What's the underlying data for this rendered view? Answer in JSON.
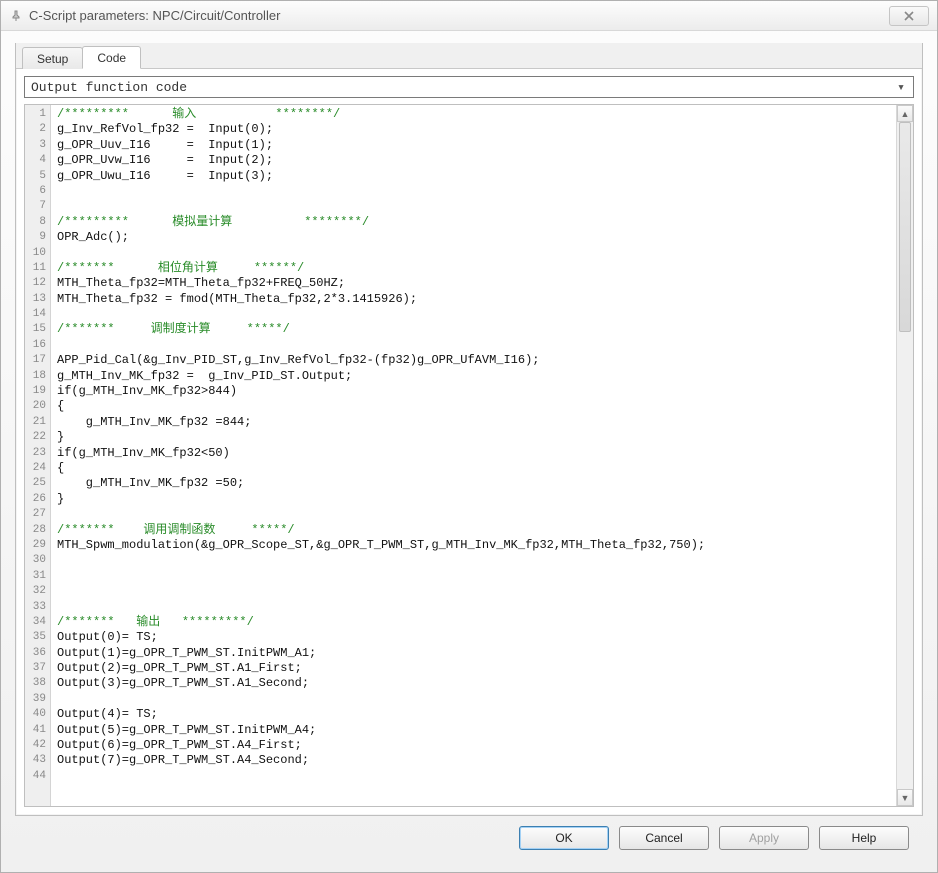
{
  "window": {
    "title": "C-Script parameters: NPC/Circuit/Controller"
  },
  "tabs": {
    "setup": "Setup",
    "code": "Code",
    "activeIndex": 1
  },
  "dropdown": {
    "selected": "Output function code"
  },
  "editor": {
    "lines": [
      {
        "n": 1,
        "t": "/*********      输入           ********/",
        "comment": true
      },
      {
        "n": 2,
        "t": "g_Inv_RefVol_fp32 =  Input(0);"
      },
      {
        "n": 3,
        "t": "g_OPR_Uuv_I16     =  Input(1);"
      },
      {
        "n": 4,
        "t": "g_OPR_Uvw_I16     =  Input(2);"
      },
      {
        "n": 5,
        "t": "g_OPR_Uwu_I16     =  Input(3);"
      },
      {
        "n": 6,
        "t": ""
      },
      {
        "n": 7,
        "t": ""
      },
      {
        "n": 8,
        "t": "/*********      模拟量计算          ********/",
        "comment": true
      },
      {
        "n": 9,
        "t": "OPR_Adc();"
      },
      {
        "n": 10,
        "t": ""
      },
      {
        "n": 11,
        "t": "/*******      相位角计算     ******/",
        "comment": true
      },
      {
        "n": 12,
        "t": "MTH_Theta_fp32=MTH_Theta_fp32+FREQ_50HZ;"
      },
      {
        "n": 13,
        "t": "MTH_Theta_fp32 = fmod(MTH_Theta_fp32,2*3.1415926);"
      },
      {
        "n": 14,
        "t": ""
      },
      {
        "n": 15,
        "t": "/*******     调制度计算     *****/",
        "comment": true
      },
      {
        "n": 16,
        "t": ""
      },
      {
        "n": 17,
        "t": "APP_Pid_Cal(&g_Inv_PID_ST,g_Inv_RefVol_fp32-(fp32)g_OPR_UfAVM_I16);"
      },
      {
        "n": 18,
        "t": "g_MTH_Inv_MK_fp32 =  g_Inv_PID_ST.Output;"
      },
      {
        "n": 19,
        "t": "if(g_MTH_Inv_MK_fp32>844)"
      },
      {
        "n": 20,
        "t": "{"
      },
      {
        "n": 21,
        "t": "    g_MTH_Inv_MK_fp32 =844;"
      },
      {
        "n": 22,
        "t": "}"
      },
      {
        "n": 23,
        "t": "if(g_MTH_Inv_MK_fp32<50)"
      },
      {
        "n": 24,
        "t": "{"
      },
      {
        "n": 25,
        "t": "    g_MTH_Inv_MK_fp32 =50;"
      },
      {
        "n": 26,
        "t": "}"
      },
      {
        "n": 27,
        "t": ""
      },
      {
        "n": 28,
        "t": "/*******    调用调制函数     *****/",
        "comment": true
      },
      {
        "n": 29,
        "t": "MTH_Spwm_modulation(&g_OPR_Scope_ST,&g_OPR_T_PWM_ST,g_MTH_Inv_MK_fp32,MTH_Theta_fp32,750);"
      },
      {
        "n": 30,
        "t": ""
      },
      {
        "n": 31,
        "t": ""
      },
      {
        "n": 32,
        "t": ""
      },
      {
        "n": 33,
        "t": ""
      },
      {
        "n": 34,
        "t": "/*******   输出   *********/",
        "comment": true
      },
      {
        "n": 35,
        "t": "Output(0)= TS;"
      },
      {
        "n": 36,
        "t": "Output(1)=g_OPR_T_PWM_ST.InitPWM_A1;"
      },
      {
        "n": 37,
        "t": "Output(2)=g_OPR_T_PWM_ST.A1_First;"
      },
      {
        "n": 38,
        "t": "Output(3)=g_OPR_T_PWM_ST.A1_Second;"
      },
      {
        "n": 39,
        "t": ""
      },
      {
        "n": 40,
        "t": "Output(4)= TS;"
      },
      {
        "n": 41,
        "t": "Output(5)=g_OPR_T_PWM_ST.InitPWM_A4;"
      },
      {
        "n": 42,
        "t": "Output(6)=g_OPR_T_PWM_ST.A4_First;"
      },
      {
        "n": 43,
        "t": "Output(7)=g_OPR_T_PWM_ST.A4_Second;"
      },
      {
        "n": 44,
        "t": ""
      }
    ]
  },
  "buttons": {
    "ok": "OK",
    "cancel": "Cancel",
    "apply": "Apply",
    "help": "Help"
  }
}
